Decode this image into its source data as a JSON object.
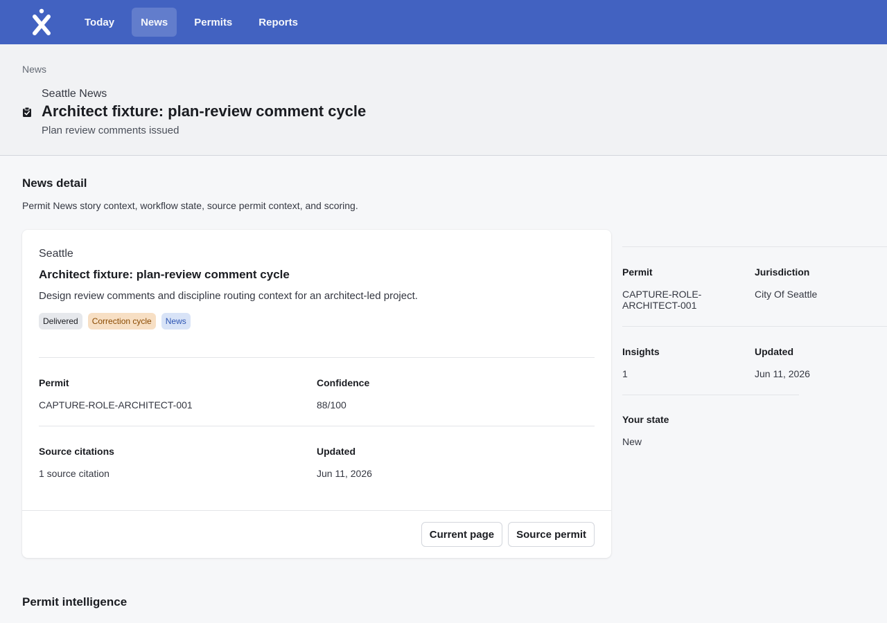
{
  "nav": {
    "tabs": [
      {
        "label": "Today"
      },
      {
        "label": "News"
      },
      {
        "label": "Permits"
      },
      {
        "label": "Reports"
      }
    ],
    "active": "News"
  },
  "header": {
    "breadcrumb": "News",
    "eyebrow": "Seattle News",
    "title": "Architect fixture: plan-review comment cycle",
    "subtitle": "Plan review comments issued",
    "icon": "clipboard-check-icon"
  },
  "main": {
    "section_title": "News detail",
    "section_desc": "Permit News story context, workflow state, source permit context, and scoring.",
    "next_section_title": "Permit intelligence"
  },
  "card": {
    "eyebrow": "Seattle",
    "title": "Architect fixture: plan-review comment cycle",
    "description": "Design review comments and discipline routing context for an architect-led project.",
    "badges": [
      {
        "label": "Delivered",
        "tone": "neutral"
      },
      {
        "label": "Correction cycle",
        "tone": "warning"
      },
      {
        "label": "News",
        "tone": "primary"
      }
    ],
    "fields": {
      "permit_label": "Permit",
      "permit_value": "CAPTURE-ROLE-ARCHITECT-001",
      "confidence_label": "Confidence",
      "confidence_value": "88/100",
      "citations_label": "Source citations",
      "citations_value": "1 source citation",
      "updated_label": "Updated",
      "updated_value": "Jun 11, 2026"
    },
    "buttons": {
      "current_page": "Current page",
      "source_permit": "Source permit"
    }
  },
  "side": {
    "permit_label": "Permit",
    "permit_value": "CAPTURE-ROLE-ARCHITECT-001",
    "jurisdiction_label": "Jurisdiction",
    "jurisdiction_value": "City Of Seattle",
    "insights_label": "Insights",
    "insights_value": "1",
    "updated_label": "Updated",
    "updated_value": "Jun 11, 2026",
    "state_label": "Your state",
    "state_value": "New"
  },
  "colors": {
    "topbar": "#4262c1",
    "badge_warning_bg": "#f7dfc4",
    "badge_primary_bg": "#d8e3f7"
  }
}
